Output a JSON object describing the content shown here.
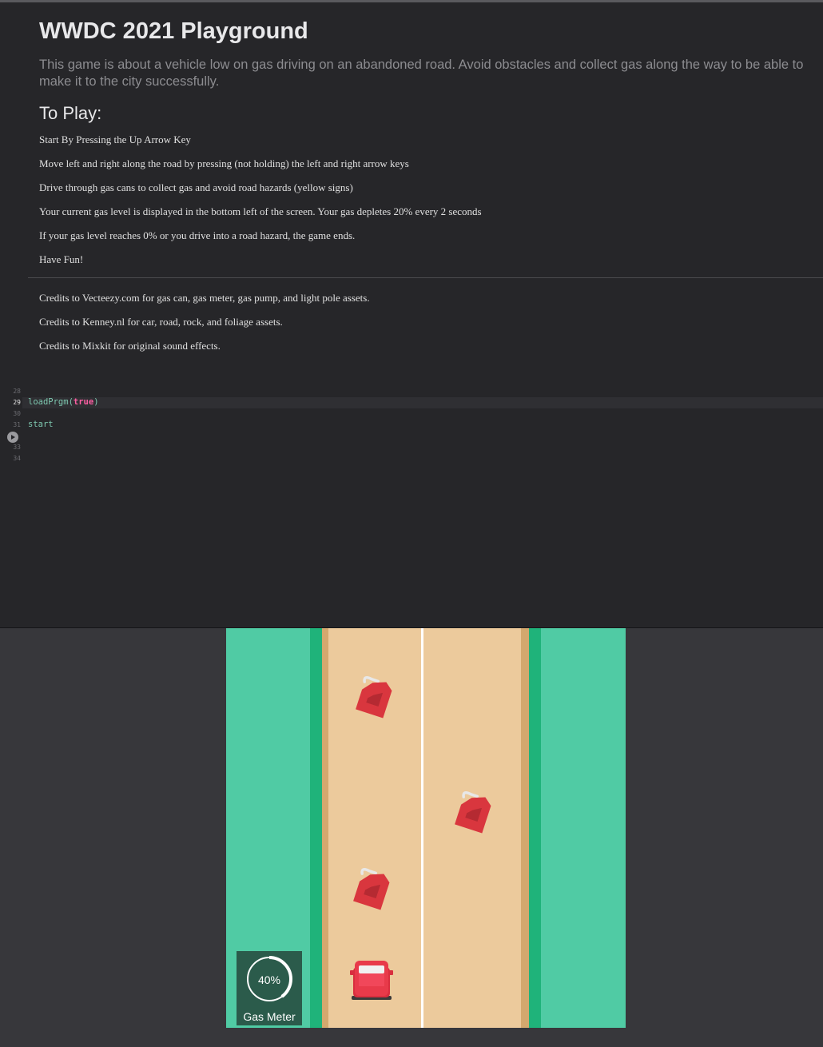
{
  "doc": {
    "title": "WWDC 2021 Playground",
    "description": "This game is about a vehicle low on gas driving on an abandoned road. Avoid obstacles and collect gas along the way to be able to make it to the city successfully.",
    "to_play_heading": "To Play:",
    "instructions": [
      "Start By Pressing the Up Arrow Key",
      "Move left and right along the road by pressing (not holding) the left and right arrow keys",
      "Drive through gas cans to collect gas and avoid road hazards (yellow signs)",
      "Your current gas level is displayed in the bottom left of the screen. Your gas depletes 20% every 2 seconds",
      "If your gas level reaches 0% or you drive into a road hazard, the game ends.",
      "Have Fun!"
    ],
    "credits": [
      "Credits to Vecteezy.com for gas can, gas meter, gas pump, and light pole assets.",
      "Credits to Kenney.nl for car, road, rock, and foliage assets.",
      "Credits to Mixkit for original sound effects."
    ]
  },
  "code": {
    "line_numbers": [
      "28",
      "29",
      "30",
      "31",
      "33",
      "34"
    ],
    "line29_fn": "loadPrgm(",
    "line29_arg": "true",
    "line29_close": ")",
    "line31": "start"
  },
  "game": {
    "gas_level": 0.4,
    "gas_percent": "40%",
    "gas_meter_label": "Gas Meter",
    "colors": {
      "grass": "#50cba4",
      "road": "#ecca9c",
      "road_edge": "#d4a86e",
      "border": "#1fb37a",
      "gas_can": "#d9363e",
      "car": "#e83a4a",
      "hud_bg": "#2b5b4b"
    }
  }
}
